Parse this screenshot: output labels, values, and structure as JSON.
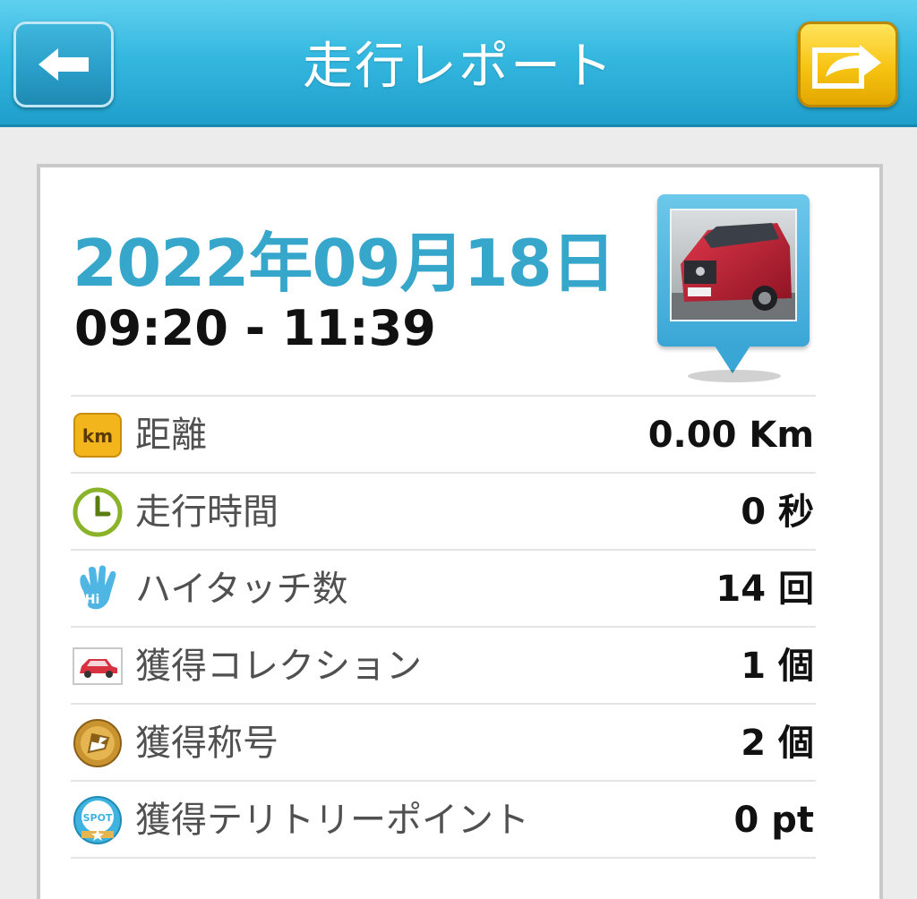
{
  "header": {
    "title": "走行レポート",
    "back_icon": "arrow-left-icon",
    "share_icon": "share-export-icon",
    "colors": {
      "bar": "#35b8e0",
      "share_button": "#f7c312"
    }
  },
  "report": {
    "date": "2022年09月18日",
    "time_range": "09:20 - 11:39",
    "photo_icon": "car-photo-pin",
    "date_color": "#36a7cb"
  },
  "rows": [
    {
      "icon": "km-badge-icon",
      "icon_text": "km",
      "label": "距離",
      "value": "0.00 Km"
    },
    {
      "icon": "clock-icon",
      "label": "走行時間",
      "value": "0 秒"
    },
    {
      "icon": "hand-hi-icon",
      "icon_text": "Hi",
      "label": "ハイタッチ数",
      "value": "14 回"
    },
    {
      "icon": "car-collection-icon",
      "label": "獲得コレクション",
      "value": "1 個"
    },
    {
      "icon": "title-medal-icon",
      "label": "獲得称号",
      "value": "2 個"
    },
    {
      "icon": "spot-point-icon",
      "icon_text": "SPOT",
      "label": "獲得テリトリーポイント",
      "value": "0 pt"
    }
  ]
}
